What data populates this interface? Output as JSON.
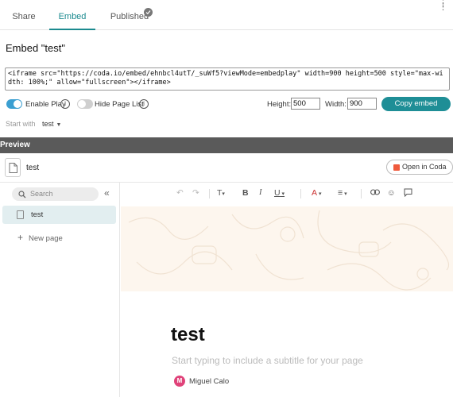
{
  "tabs": {
    "share": "Share",
    "embed": "Embed",
    "published": "Published"
  },
  "embed": {
    "title": "Embed \"test\"",
    "code": "<iframe src=\"https://coda.io/embed/ehnbcl4utT/_suWf5?viewMode=embedplay\" width=900 height=500 style=\"max-width: 100%;\" allow=\"fullscreen\"></iframe>",
    "enable_play_label": "Enable Play",
    "enable_play_on": true,
    "hide_page_list_label": "Hide Page List",
    "hide_page_list_on": false,
    "height_label": "Height:",
    "height_value": "500",
    "width_label": "Width:",
    "width_value": "900",
    "copy_button": "Copy embed",
    "start_with_label": "Start with",
    "start_with_value": "test"
  },
  "preview": {
    "label": "Preview",
    "doc_name": "test",
    "open_button": "Open in Coda"
  },
  "sidebar": {
    "search_placeholder": "Search",
    "pages": [
      {
        "label": "test"
      }
    ],
    "new_page_label": "New page"
  },
  "canvas": {
    "title": "test",
    "subtitle_placeholder": "Start typing to include a subtitle for your page",
    "author_initial": "M",
    "author_name": "Miguel Calo"
  },
  "colors": {
    "accent": "#1e8e96",
    "toggle_on": "#3b9fd1",
    "avatar": "#e0437a",
    "cover": "#fdf6ee"
  }
}
